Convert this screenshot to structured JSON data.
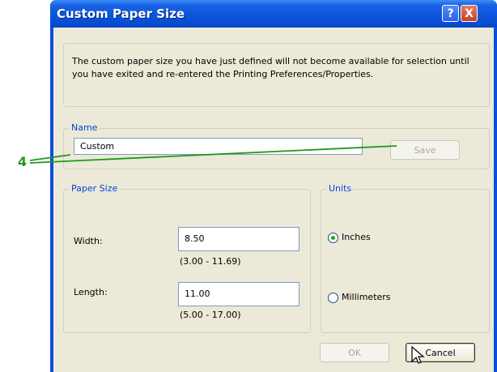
{
  "window": {
    "title": "Custom Paper Size",
    "help_icon": "?",
    "close_icon": "X"
  },
  "info": {
    "text": "The custom paper size you have just defined will not become available for selection until you have exited and re-entered the Printing Preferences/Properties."
  },
  "name_group": {
    "legend": "Name",
    "value": "Custom",
    "save_label": "Save"
  },
  "paper_size": {
    "legend": "Paper Size",
    "width_label": "Width:",
    "width_value": "8.50",
    "width_range": "(3.00 - 11.69)",
    "length_label": "Length:",
    "length_value": "11.00",
    "length_range": "(5.00 - 17.00)"
  },
  "units": {
    "legend": "Units",
    "options": [
      "Inches",
      "Millimeters"
    ],
    "selected": "Inches"
  },
  "buttons": {
    "ok_label": "OK",
    "cancel_label": "Cancel"
  },
  "callout": {
    "number": "4",
    "color": "#1c9a1c"
  },
  "colors": {
    "titlebar": "#0a54dc",
    "client": "#ece9d8",
    "legend_text": "#0046d5"
  }
}
